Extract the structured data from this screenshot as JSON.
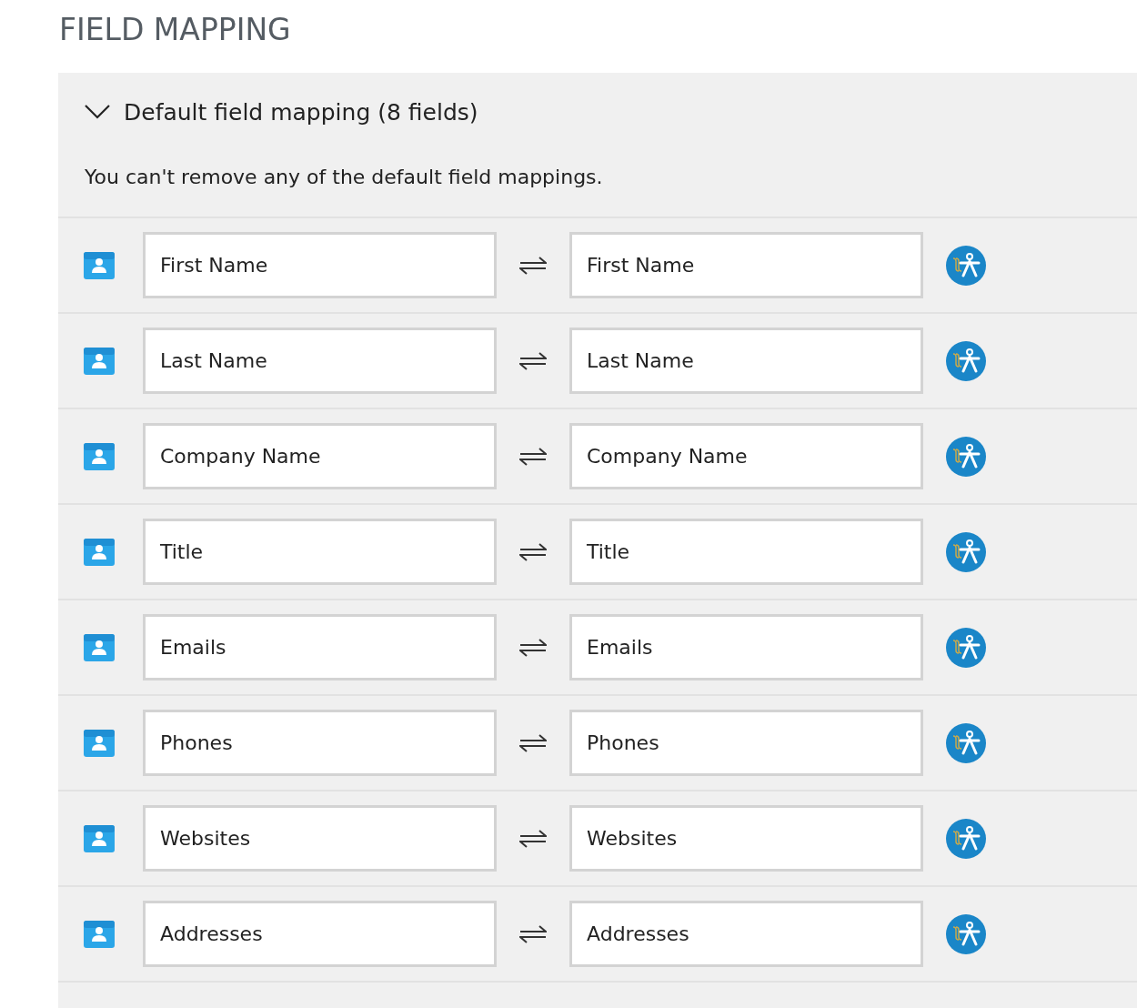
{
  "title": "FIELD MAPPING",
  "section": {
    "title": "Default field mapping (8 fields)",
    "expanded": true,
    "description": "You can't remove any of the default field mappings."
  },
  "mappings": [
    {
      "source": "First Name",
      "target": "First Name"
    },
    {
      "source": "Last Name",
      "target": "Last Name"
    },
    {
      "source": "Company Name",
      "target": "Company Name"
    },
    {
      "source": "Title",
      "target": "Title"
    },
    {
      "source": "Emails",
      "target": "Emails"
    },
    {
      "source": "Phones",
      "target": "Phones"
    },
    {
      "source": "Websites",
      "target": "Websites"
    },
    {
      "source": "Addresses",
      "target": "Addresses"
    }
  ]
}
